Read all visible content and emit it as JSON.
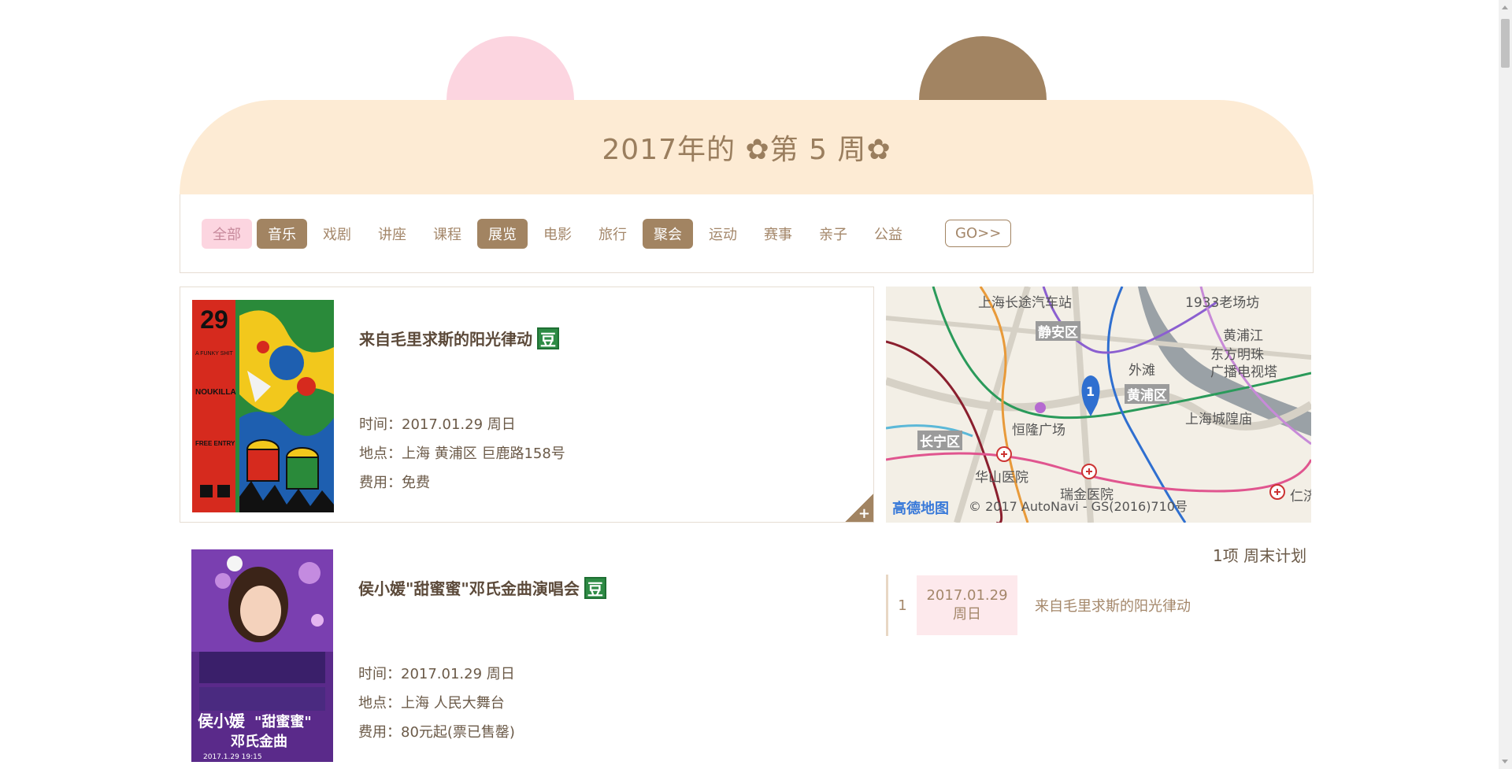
{
  "header": {
    "year_text": "2017年的",
    "flower": "✿",
    "week_text": "第 5 周"
  },
  "categories": [
    {
      "label": "全部",
      "state": "all"
    },
    {
      "label": "音乐",
      "state": "active"
    },
    {
      "label": "戏剧",
      "state": "normal"
    },
    {
      "label": "讲座",
      "state": "normal"
    },
    {
      "label": "课程",
      "state": "normal"
    },
    {
      "label": "展览",
      "state": "active"
    },
    {
      "label": "电影",
      "state": "normal"
    },
    {
      "label": "旅行",
      "state": "normal"
    },
    {
      "label": "聚会",
      "state": "active"
    },
    {
      "label": "运动",
      "state": "normal"
    },
    {
      "label": "赛事",
      "state": "normal"
    },
    {
      "label": "亲子",
      "state": "normal"
    },
    {
      "label": "公益",
      "state": "normal"
    }
  ],
  "go_button": "GO>>",
  "events": [
    {
      "title": "来自毛里求斯的阳光律动",
      "badge": "豆",
      "time": "时间：2017.01.29 周日",
      "place": "地点：上海 黄浦区 巨鹿路158号",
      "fee": "费用：免费",
      "poster_text": {
        "date": "29",
        "lines": [
          "A FUNKY SHIT",
          "NOUKILLA",
          "FREE ENTRY"
        ]
      }
    },
    {
      "title": "侯小媛\"甜蜜蜜\"邓氏金曲演唱会",
      "badge": "豆",
      "time": "时间：2017.01.29 周日",
      "place": "地点：上海 人民大舞台",
      "fee": "费用：80元起(票已售罄)",
      "poster_text": {
        "name": "侯小媛",
        "subtitle": "\"甜蜜蜜\"",
        "subtitle2": "邓氏金曲",
        "date": "2017.1.29 19:15"
      }
    }
  ],
  "corner_plus": "+",
  "map": {
    "labels": [
      "上海长途汽车站",
      "1933老场坊",
      "黄浦江",
      "东方明珠",
      "广播电视塔",
      "外滩",
      "恒隆广场",
      "上海城隍庙",
      "华山医院",
      "瑞金医院",
      "仁济"
    ],
    "districts": [
      "静安区",
      "黄浦区",
      "长宁区"
    ],
    "pin_number": "1",
    "logo": "高德地图",
    "copyright": "© 2017 AutoNavi - GS(2016)710号"
  },
  "plan": {
    "count_text": "1项 周末计划",
    "rows": [
      {
        "index": "1",
        "date": "2017.01.29",
        "weekday": "周日",
        "title": "来自毛里求斯的阳光律动"
      }
    ]
  }
}
